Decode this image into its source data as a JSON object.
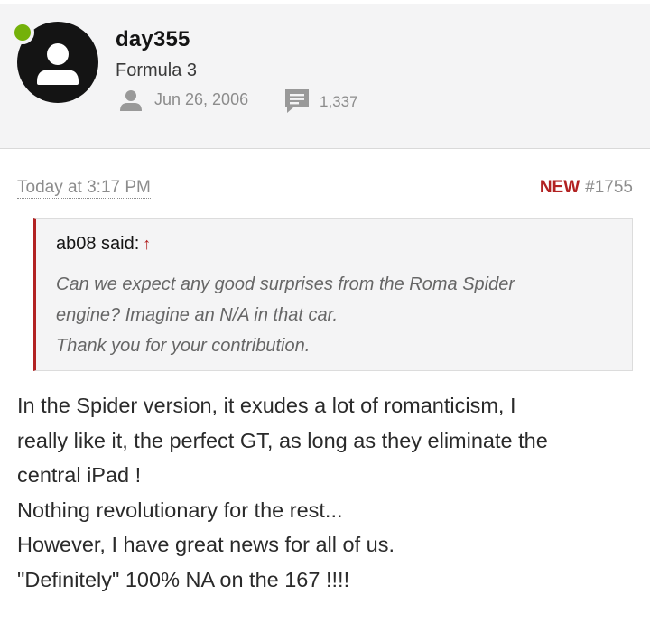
{
  "user": {
    "name": "day355",
    "title": "Formula 3",
    "join_date": "Jun 26, 2006",
    "message_count": "1,337",
    "online_color": "#74b10a"
  },
  "post": {
    "time": "Today at 3:17 PM",
    "new_label": "NEW",
    "number": "#1755",
    "quote": {
      "author_label": "ab08 said:",
      "arrow": "↑",
      "lines": [
        "Can we expect any good surprises from the Roma Spider",
        "engine? Imagine an N/A in that car.",
        "Thank you for your contribution."
      ]
    },
    "body_lines": [
      "In the Spider version, it exudes a lot of romanticism, I",
      "really like it, the perfect GT, as long as they eliminate the",
      "central iPad !",
      "Nothing revolutionary for the rest...",
      "However, I have great news for all of us.",
      "\"Definitely\" 100% NA on the 167 !!!!"
    ]
  },
  "colors": {
    "accent": "#b22222",
    "muted": "#8c8c8c",
    "header_bg": "#f4f4f5"
  }
}
